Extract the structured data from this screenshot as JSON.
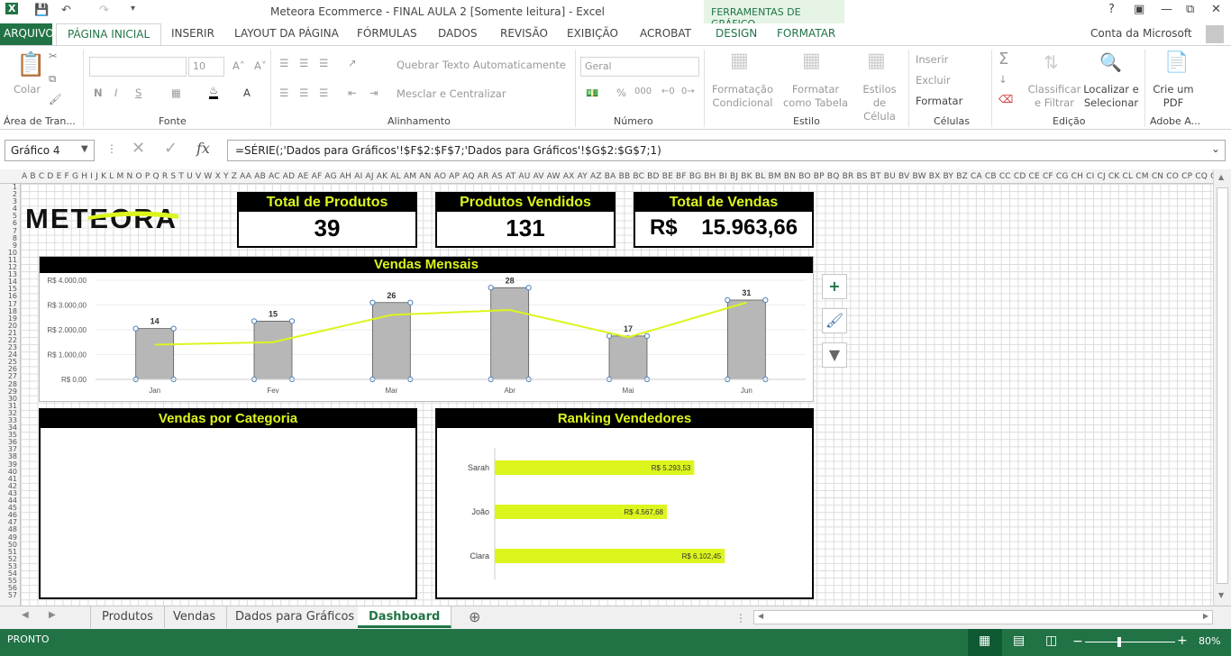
{
  "app": {
    "title": "Meteora Ecommerce - FINAL AULA 2  [Somente leitura] - Excel",
    "tools_title": "FERRAMENTAS DE GRÁFICO",
    "account": "Conta da Microsoft",
    "help": "?",
    "accent": "#217346"
  },
  "tabs": {
    "file": "ARQUIVO",
    "items": [
      "PÁGINA INICIAL",
      "INSERIR",
      "LAYOUT DA PÁGINA",
      "FÓRMULAS",
      "DADOS",
      "REVISÃO",
      "EXIBIÇÃO",
      "ACROBAT",
      "DESIGN",
      "FORMATAR"
    ]
  },
  "ribbon": {
    "clipboard": {
      "paste": "Colar",
      "label": "Área de Tran..."
    },
    "font": {
      "size": "10",
      "label": "Fonte",
      "bold": "N",
      "italic": "I",
      "underline": "S"
    },
    "alignment": {
      "wrap": "Quebrar Texto Automaticamente",
      "merge": "Mesclar e Centralizar",
      "label": "Alinhamento"
    },
    "number": {
      "format": "Geral",
      "percent": "%",
      "thousands": "000",
      "label": "Número"
    },
    "styles": {
      "conditional": "Formatação Condicional",
      "table": "Formatar como Tabela",
      "cell": "Estilos de Célula",
      "label": "Estilo"
    },
    "cells": {
      "insert": "Inserir",
      "delete": "Excluir",
      "format": "Formatar",
      "label": "Células"
    },
    "editing": {
      "sort": "Classificar e Filtrar",
      "find": "Localizar e Selecionar",
      "label": "Edição"
    },
    "adobe": {
      "create": "Crie um PDF",
      "label": "Adobe A..."
    }
  },
  "formula_bar": {
    "name_box": "Gráfico 4",
    "fx": "fx",
    "formula": "=SÉRIE(;'Dados para Gráficos'!$F$2:$F$7;'Dados para Gráficos'!$G$2:$G$7;1)"
  },
  "columns": "A B C D E F G H I J K L M N O P Q R S T U V W X Y Z AA AB AC AD AE AF AG AH AI AJ AK AL AM AN AO AP AQ AR AS AT AU AV AW AX AY AZ BA BB BC BD BE BF BG BH BI BJ BK BL BM BN BO BP BQ BR BS BT BU BV BW BX BY BZ CA CB CC CD CE CF CG CH CI CJ CK CL CM CN CO CP CQ CR CS CT CU CV CW CX CY CZ DA DB DC DD DE DF DG DH DI DJ DK DL DM DN DO",
  "dashboard": {
    "logo": "METEORA",
    "kpis": [
      {
        "label": "Total de Produtos",
        "value": "39"
      },
      {
        "label": "Produtos Vendidos",
        "value": "131"
      },
      {
        "label": "Total de Vendas",
        "value": "R$    15.963,66"
      }
    ],
    "monthly_title": "Vendas Mensais",
    "category_title": "Vendas por Categoria",
    "ranking_title": "Ranking Vendedores"
  },
  "chart_data": [
    {
      "type": "bar",
      "title": "Vendas Mensais",
      "categories": [
        "Jan",
        "Fev",
        "Mar",
        "Abr",
        "Mai",
        "Jun"
      ],
      "yticks": [
        "R$ 0,00",
        "R$ 1.000,00",
        "R$ 2.000,00",
        "R$ 3.000,00",
        "R$ 4.000,00"
      ],
      "ylim": [
        0,
        4000
      ],
      "series": [
        {
          "type": "bar",
          "values": [
            2050,
            2350,
            3100,
            3700,
            1750,
            3200
          ],
          "labels": [
            "14",
            "15",
            "26",
            "28",
            "17",
            "31"
          ]
        },
        {
          "type": "line",
          "values": [
            14,
            15,
            26,
            28,
            17,
            31
          ],
          "ylim": [
            0,
            40
          ]
        }
      ],
      "bar_color": "#b7b7b7",
      "line_color": "#dcf51d"
    },
    {
      "type": "bar",
      "orientation": "horizontal",
      "title": "Ranking Vendedores",
      "categories": [
        "Sarah",
        "João",
        "Clara"
      ],
      "values": [
        5293.53,
        4567.68,
        6102.45
      ],
      "labels": [
        "R$ 5.293,53",
        "R$ 4.567,68",
        "R$ 6.102,45"
      ],
      "xlim": [
        0,
        6600
      ],
      "bar_color": "#dcf51d"
    }
  ],
  "sheets": [
    "Produtos",
    "Vendas",
    "Dados para Gráficos",
    "Dashboard"
  ],
  "active_sheet": "Dashboard",
  "status": {
    "ready": "PRONTO",
    "zoom": "80%"
  }
}
